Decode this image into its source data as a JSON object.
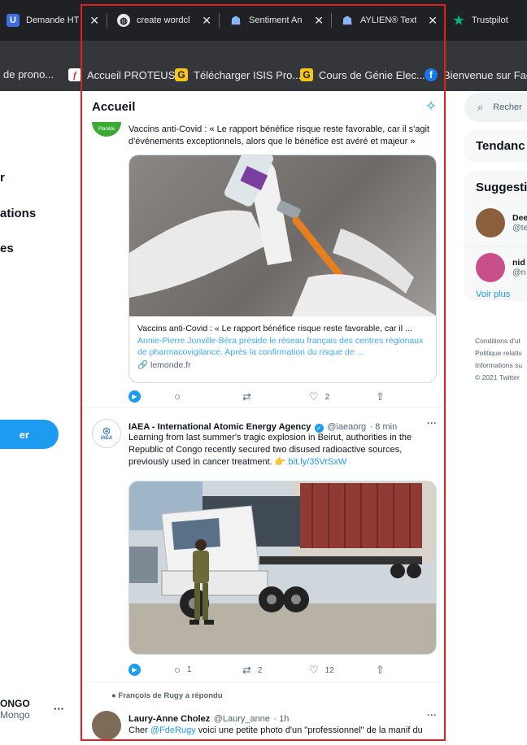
{
  "browser": {
    "tabs": [
      {
        "title": "Demande HT",
        "icon": "ui-icon"
      },
      {
        "title": "create wordcl",
        "icon": "globe-icon"
      },
      {
        "title": "Sentiment An",
        "icon": "alien-icon"
      },
      {
        "title": "AYLIEN® Text",
        "icon": "alien-icon"
      },
      {
        "title": "Trustpilot",
        "icon": "star-icon"
      }
    ],
    "close_glyph": "✕",
    "bookmarks": [
      {
        "label": "de prono...",
        "icon": "none"
      },
      {
        "label": "Accueil PROTEUS",
        "icon": "proteus-icon"
      },
      {
        "label": "Télécharger ISIS Pro...",
        "icon": "g-icon"
      },
      {
        "label": "Cours de Génie Elec...",
        "icon": "g-icon"
      },
      {
        "label": "Bienvenue sur Face",
        "icon": "facebook-icon"
      }
    ]
  },
  "left_nav": {
    "items": [
      "r",
      "ations",
      "es"
    ],
    "tweet_button": "er",
    "account_name": "ONGO",
    "account_handle": "Mongo",
    "more_glyph": "···"
  },
  "main": {
    "title": "Accueil",
    "tweets": [
      {
        "text": "Vaccins anti-Covid : « Le rapport bénéfice risque reste favorable, car il s'agit d'événements exceptionnels, alors que le bénéfice est avéré et majeur »",
        "avatar_label": "Planète",
        "card": {
          "title": "Vaccins anti-Covid : « Le rapport bénéfice risque reste favorable, car il ...",
          "desc": "Annie-Pierre Jonville-Béra préside le réseau français des centres régionaux de pharmacovigilance. Après la confirmation du risque de ...",
          "domain": "lemonde.fr"
        },
        "actions": {
          "replies": "",
          "retweets": "",
          "likes": "2"
        }
      },
      {
        "name": "IAEA - International Atomic Energy Agency",
        "handle": "@iaeaorg",
        "time": "· 8 min",
        "avatar_label": "IAEA",
        "text_main": "Learning from last summer's tragic explosion in Beirut, authorities in the Republic of Congo recently secured two disused radioactive sources, previously used in cancer treatment.",
        "link_text": "bit.ly/35VrSxW",
        "actions": {
          "replies": "1",
          "retweets": "2",
          "likes": "12"
        }
      },
      {
        "context": "François de Rugy a répondu",
        "name": "Laury-Anne Cholez",
        "handle": "@Laury_anne",
        "time": "· 1h",
        "text_prefix": "Cher ",
        "mention": "@FdeRugy",
        "text_rest": " voici une petite photo d'un \"professionnel\" de la manif du"
      }
    ],
    "more_glyph": "···"
  },
  "right": {
    "search_placeholder": "Recher",
    "trends_title": "Tendanc",
    "suggestions_title": "Suggesti",
    "suggestions": [
      {
        "name": "Dee",
        "handle": "@te"
      },
      {
        "name": "nid",
        "handle": "@n"
      }
    ],
    "see_more": "Voir plus",
    "footer": [
      "Conditions d'ut",
      "Politique relativ",
      "Informations su",
      "© 2021 Twitter"
    ]
  },
  "colors": {
    "accent": "#1d9bf0",
    "highlight": "#e02020"
  }
}
